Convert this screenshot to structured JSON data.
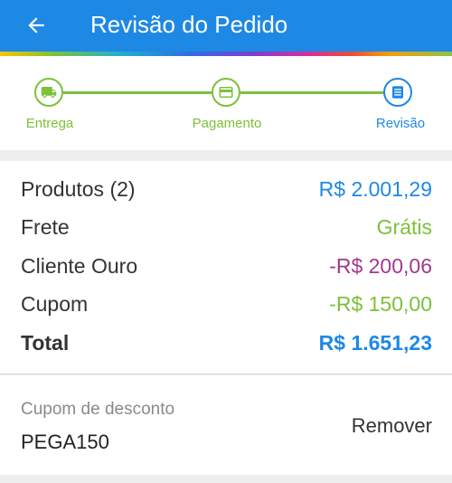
{
  "header": {
    "title": "Revisão do Pedido",
    "back_icon": "arrow-left-icon"
  },
  "stepper": {
    "steps": [
      {
        "label": "Entrega",
        "icon": "truck-icon",
        "state": "done"
      },
      {
        "label": "Pagamento",
        "icon": "credit-card-icon",
        "state": "done"
      },
      {
        "label": "Revisão",
        "icon": "list-icon",
        "state": "current"
      }
    ]
  },
  "summary": {
    "rows": [
      {
        "label": "Produtos (2)",
        "value": "R$ 2.001,29",
        "color": "#1e88e5"
      },
      {
        "label": "Frete",
        "value": "Grátis",
        "color": "#7cc13a"
      },
      {
        "label": "Cliente Ouro",
        "value": "-R$ 200,06",
        "color": "#a23a8f"
      },
      {
        "label": "Cupom",
        "value": "-R$ 150,00",
        "color": "#7cc13a"
      },
      {
        "label": "Total",
        "value": "R$ 1.651,23",
        "color": "#1e88e5"
      }
    ]
  },
  "coupon": {
    "caption": "Cupom de desconto",
    "code": "PEGA150",
    "remove_label": "Remover"
  },
  "colors": {
    "primary": "#1e88e5",
    "success": "#7cc13a",
    "gold": "#a23a8f"
  }
}
